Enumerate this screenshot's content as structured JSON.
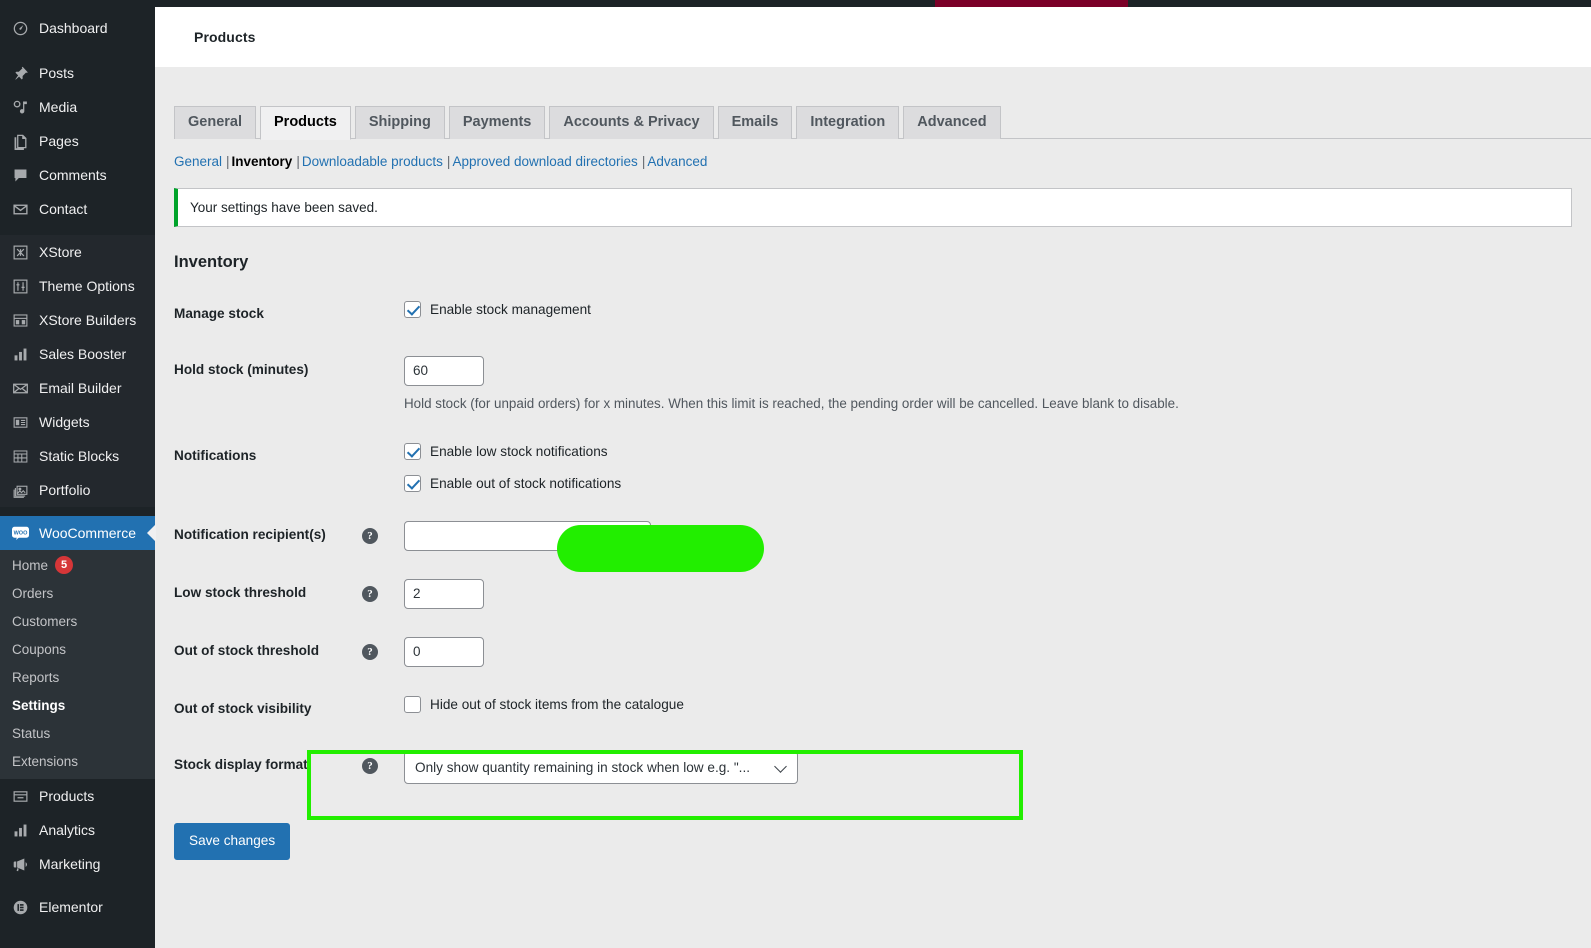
{
  "adminbar": {
    "accent_color": "#7b0028"
  },
  "sidebar": {
    "primary": [
      {
        "label": "Dashboard",
        "icon": "dashboard-icon"
      },
      {
        "label": "Posts",
        "icon": "pin-icon"
      },
      {
        "label": "Media",
        "icon": "media-icon"
      },
      {
        "label": "Pages",
        "icon": "pages-icon"
      },
      {
        "label": "Comments",
        "icon": "comments-icon"
      },
      {
        "label": "Contact",
        "icon": "envelope-icon"
      }
    ],
    "theme": [
      {
        "label": "XStore",
        "icon": "xstore-icon"
      },
      {
        "label": "Theme Options",
        "icon": "sliders-icon"
      },
      {
        "label": "XStore Builders",
        "icon": "builders-icon"
      },
      {
        "label": "Sales Booster",
        "icon": "bars-icon"
      },
      {
        "label": "Email Builder",
        "icon": "mail-icon"
      },
      {
        "label": "Widgets",
        "icon": "widgets-icon"
      },
      {
        "label": "Static Blocks",
        "icon": "blocks-icon"
      },
      {
        "label": "Portfolio",
        "icon": "portfolio-icon"
      }
    ],
    "woocommerce": {
      "label": "WooCommerce",
      "icon": "woo-icon",
      "submenu": [
        {
          "label": "Home",
          "badge": "5"
        },
        {
          "label": "Orders"
        },
        {
          "label": "Customers"
        },
        {
          "label": "Coupons"
        },
        {
          "label": "Reports"
        },
        {
          "label": "Settings",
          "active": true
        },
        {
          "label": "Status"
        },
        {
          "label": "Extensions"
        }
      ]
    },
    "store": [
      {
        "label": "Products",
        "icon": "products-icon"
      },
      {
        "label": "Analytics",
        "icon": "analytics-icon"
      },
      {
        "label": "Marketing",
        "icon": "megaphone-icon"
      }
    ],
    "plugins": [
      {
        "label": "Elementor",
        "icon": "elementor-icon"
      }
    ]
  },
  "page": {
    "title": "Products"
  },
  "tabs": [
    {
      "label": "General",
      "active": false
    },
    {
      "label": "Products",
      "active": true
    },
    {
      "label": "Shipping",
      "active": false
    },
    {
      "label": "Payments",
      "active": false
    },
    {
      "label": "Accounts & Privacy",
      "active": false
    },
    {
      "label": "Emails",
      "active": false
    },
    {
      "label": "Integration",
      "active": false
    },
    {
      "label": "Advanced",
      "active": false
    }
  ],
  "subtabs": [
    {
      "label": "General",
      "current": false
    },
    {
      "label": "Inventory",
      "current": true
    },
    {
      "label": "Downloadable products",
      "current": false
    },
    {
      "label": "Approved download directories",
      "current": false
    },
    {
      "label": "Advanced",
      "current": false
    }
  ],
  "notice": {
    "text": "Your settings have been saved.",
    "accent_color": "#00a32a"
  },
  "section": {
    "heading": "Inventory"
  },
  "fields": {
    "manage_stock": {
      "label": "Manage stock",
      "checkbox_label": "Enable stock management",
      "checked": true
    },
    "hold_stock": {
      "label": "Hold stock (minutes)",
      "value": "60",
      "description": "Hold stock (for unpaid orders) for x minutes. When this limit is reached, the pending order will be cancelled. Leave blank to disable."
    },
    "notifications": {
      "label": "Notifications",
      "low_stock_label": "Enable low stock notifications",
      "low_stock_checked": true,
      "out_of_stock_label": "Enable out of stock notifications",
      "out_of_stock_checked": true
    },
    "notification_recipients": {
      "label": "Notification recipient(s)",
      "help": "?",
      "value": "",
      "redacted": true,
      "redaction_color": "#22ee00"
    },
    "low_stock_threshold": {
      "label": "Low stock threshold",
      "help": "?",
      "value": "2"
    },
    "out_of_stock_threshold": {
      "label": "Out of stock threshold",
      "help": "?",
      "value": "0"
    },
    "out_of_stock_visibility": {
      "label": "Out of stock visibility",
      "checkbox_label": "Hide out of stock items from the catalogue",
      "checked": false
    },
    "stock_display_format": {
      "label": "Stock display format",
      "help": "?",
      "selected": "Only show quantity remaining in stock when low e.g. \"...",
      "highlighted": true,
      "highlight_color": "#22ee00"
    }
  },
  "submit": {
    "save_label": "Save changes",
    "accent_color": "#2271b1"
  }
}
